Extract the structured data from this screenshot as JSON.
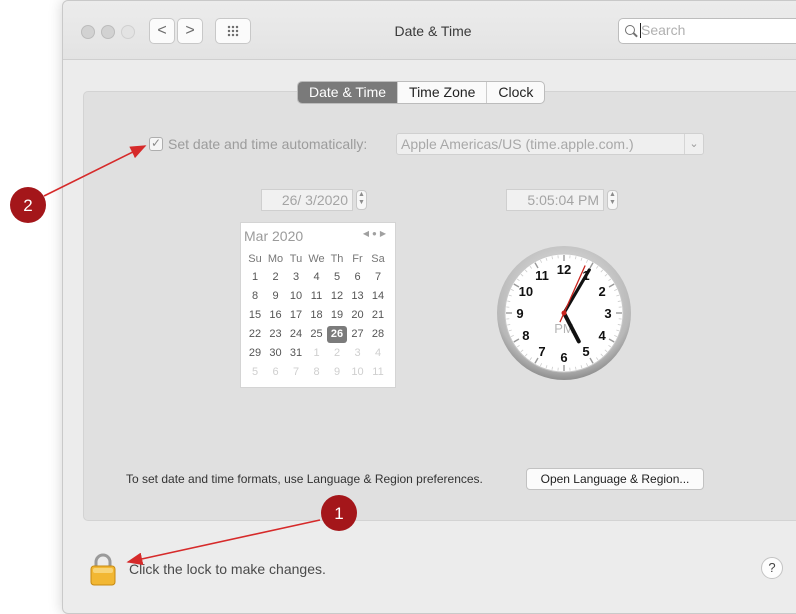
{
  "window": {
    "title": "Date & Time",
    "search_placeholder": "Search",
    "nav_back": "<",
    "nav_forward": ">"
  },
  "tabs": [
    {
      "label": "Date & Time",
      "active": true
    },
    {
      "label": "Time Zone",
      "active": false
    },
    {
      "label": "Clock",
      "active": false
    }
  ],
  "auto_time": {
    "checked": true,
    "label": "Set date and time automatically:",
    "server": "Apple Americas/US (time.apple.com.)"
  },
  "date_field": "26/  3/2020",
  "time_field": "5:05:04 PM",
  "calendar": {
    "month_label": "Mar 2020",
    "weekdays": [
      "Su",
      "Mo",
      "Tu",
      "We",
      "Th",
      "Fr",
      "Sa"
    ],
    "rows": [
      [
        "1",
        "2",
        "3",
        "4",
        "5",
        "6",
        "7"
      ],
      [
        "8",
        "9",
        "10",
        "11",
        "12",
        "13",
        "14"
      ],
      [
        "15",
        "16",
        "17",
        "18",
        "19",
        "20",
        "21"
      ],
      [
        "22",
        "23",
        "24",
        "25",
        "26",
        "27",
        "28"
      ],
      [
        "29",
        "30",
        "31",
        "1",
        "2",
        "3",
        "4"
      ],
      [
        "5",
        "6",
        "7",
        "8",
        "9",
        "10",
        "11"
      ]
    ],
    "selected_day": "26"
  },
  "clock": {
    "numbers": [
      "12",
      "1",
      "2",
      "3",
      "4",
      "5",
      "6",
      "7",
      "8",
      "9",
      "10",
      "11"
    ],
    "ampm": "PM",
    "hour": 5,
    "minute": 5,
    "second": 4
  },
  "footer": {
    "formats_note": "To set date and time formats, use Language & Region preferences.",
    "open_button": "Open Language & Region...",
    "lock_text": "Click the lock to make changes.",
    "help": "?"
  },
  "annotations": [
    {
      "number": "1"
    },
    {
      "number": "2"
    }
  ],
  "colors": {
    "annotation_red": "#a4161a",
    "arrow_red": "#d62a2a",
    "lock_gold": "#f2b733",
    "second_hand": "#c8221c"
  }
}
